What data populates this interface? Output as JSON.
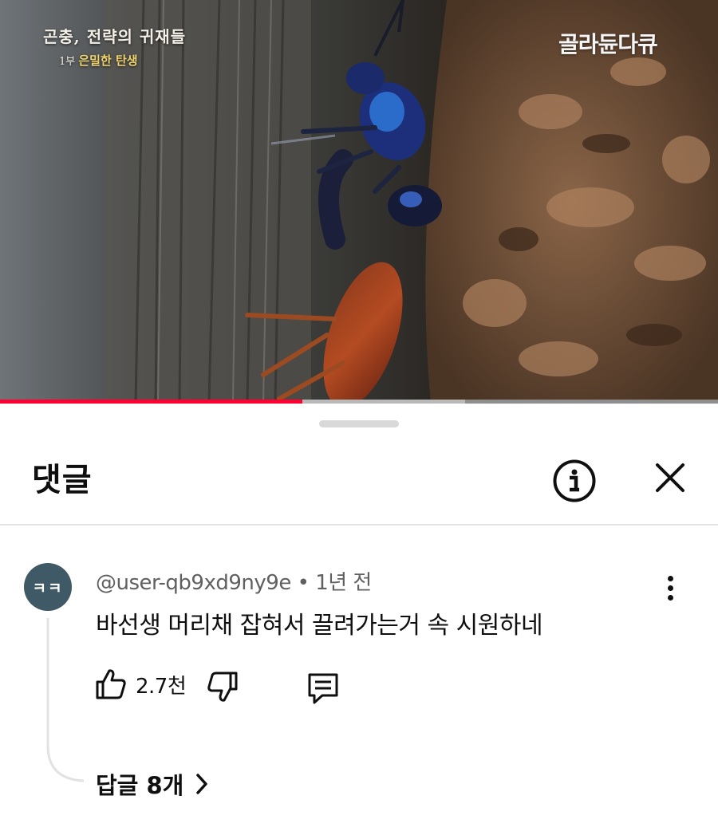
{
  "video": {
    "overlay_title": "곤충, 전략의 귀재들",
    "overlay_episode": "1부",
    "overlay_subtitle": "은밀한 탄생",
    "channel_watermark": "골라듄다큐",
    "progress_played_fraction": 0.421,
    "progress_buffered_fraction": 0.648
  },
  "comments_sheet": {
    "title": "댓글",
    "info_icon": "info-circle-icon",
    "close_icon": "close-icon"
  },
  "comment": {
    "avatar_text": "ㅋㅋ",
    "author": "@user-qb9xd9ny9e",
    "separator": "•",
    "time": "1년 전",
    "text": "바선생 머리채 잡혀서 끌려가는거 속 시원하네",
    "like_count": "2.7천",
    "replies_label": "답글 8개"
  },
  "colors": {
    "accent_red": "#ff0033",
    "avatar_bg": "#3f5966",
    "meta_gray": "#606060"
  }
}
